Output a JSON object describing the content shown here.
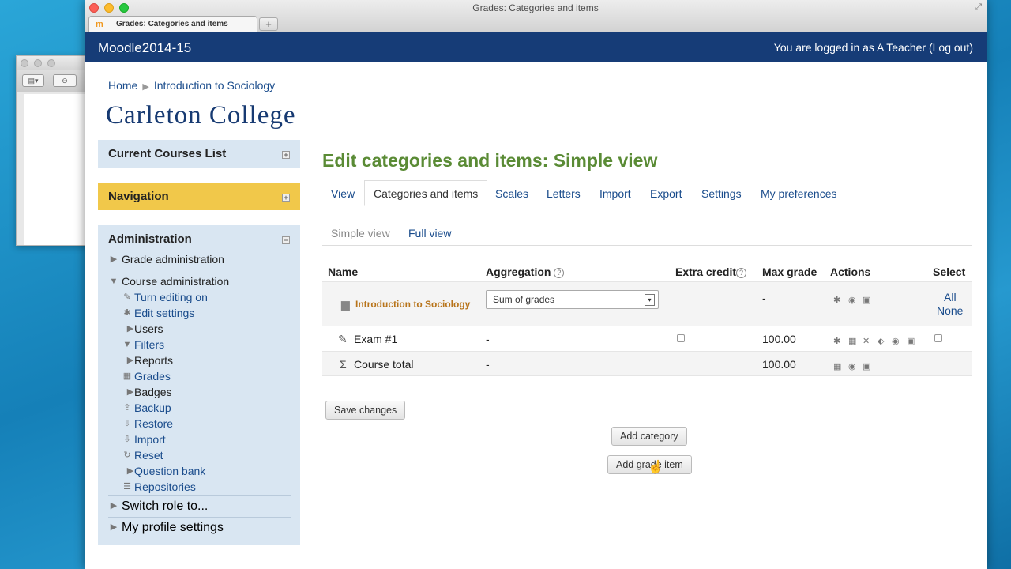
{
  "browser": {
    "window_title": "Grades: Categories and items",
    "tab_title": "Grades: Categories and items",
    "favicon": "m",
    "new_tab": "+"
  },
  "navbar": {
    "brand": "Moodle2014-15",
    "login_prefix": "You are logged in as ",
    "user": "A Teacher",
    "logout": "(Log out)"
  },
  "breadcrumb": {
    "home": "Home",
    "sep": "▶",
    "course": "Introduction to Sociology"
  },
  "logo_text": "Carleton College",
  "blocks": {
    "current_courses": "Current Courses List",
    "navigation": "Navigation",
    "administration": "Administration",
    "admin_items": [
      {
        "label": "Grade administration",
        "icon": "▶",
        "link": false
      },
      {
        "label": "Course administration",
        "icon": "▼",
        "link": false
      },
      {
        "label": "Turn editing on",
        "icon": "✎",
        "link": true
      },
      {
        "label": "Edit settings",
        "icon": "✱",
        "link": true
      },
      {
        "label": "Users",
        "icon": "▶",
        "link": false
      },
      {
        "label": "Filters",
        "icon": "▼",
        "link": true
      },
      {
        "label": "Reports",
        "icon": "▶",
        "link": false
      },
      {
        "label": "Grades",
        "icon": "▦",
        "link": true
      },
      {
        "label": "Badges",
        "icon": "▶",
        "link": false
      },
      {
        "label": "Backup",
        "icon": "⇪",
        "link": true
      },
      {
        "label": "Restore",
        "icon": "⇩",
        "link": true
      },
      {
        "label": "Import",
        "icon": "⇩",
        "link": true
      },
      {
        "label": "Reset",
        "icon": "↻",
        "link": true
      },
      {
        "label": "Question bank",
        "icon": "▶",
        "link": true
      },
      {
        "label": "Repositories",
        "icon": "☰",
        "link": true
      }
    ],
    "switch_role": "Switch role to...",
    "profile_settings": "My profile settings"
  },
  "page": {
    "title": "Edit categories and items: Simple view",
    "tabs": [
      "View",
      "Categories and items",
      "Scales",
      "Letters",
      "Import",
      "Export",
      "Settings",
      "My preferences"
    ],
    "active_tab": "Categories and items",
    "subtabs": [
      "Simple view",
      "Full view"
    ]
  },
  "table": {
    "headers": [
      "Name",
      "Aggregation",
      "Extra credit",
      "Max grade",
      "Actions",
      "Select"
    ],
    "category": {
      "name": "Introduction to Sociology",
      "aggregation": "Sum of grades",
      "max_grade": "-",
      "select_all": "All",
      "select_none": "None"
    },
    "item": {
      "name": "Exam #1",
      "aggregation": "-",
      "max_grade": "100.00"
    },
    "total": {
      "name": "Course total",
      "aggregation": "-",
      "max_grade": "100.00"
    }
  },
  "buttons": {
    "save": "Save changes",
    "add_category": "Add category",
    "add_grade_item": "Add grade item"
  },
  "colors": {
    "navbar": "#163c77",
    "title_green": "#5a8b35",
    "link_blue": "#1a4c8c",
    "nav_yellow": "#f1c84a",
    "block_bg": "#d9e6f2"
  }
}
